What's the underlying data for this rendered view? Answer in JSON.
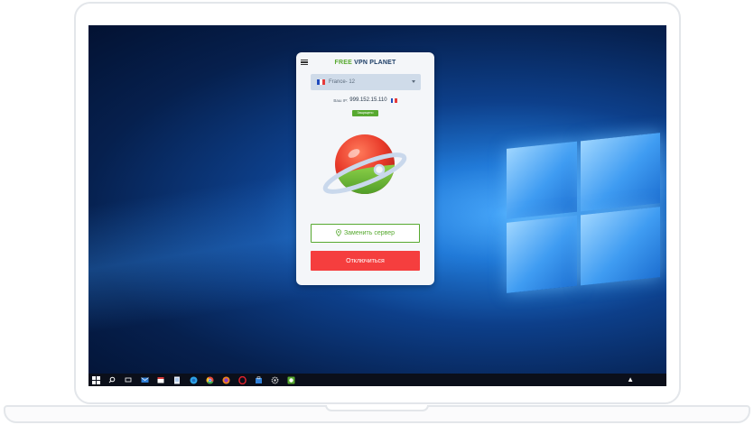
{
  "app": {
    "title_free": "FREE",
    "title_rest": " VPN PLANET",
    "server": {
      "selected": "France- 12",
      "flag_colors": [
        "#1f4bbd",
        "#ffffff",
        "#e53b3b"
      ]
    },
    "ip": {
      "label": "Ваш IP:",
      "value": "999.152.15.110"
    },
    "status_badge": "Защищено",
    "change_server_label": "Заменить сервер",
    "disconnect_label": "Отключиться",
    "colors": {
      "accent_green": "#57a930",
      "danger_red": "#f53e3e",
      "title_blue": "#1c3d66"
    }
  },
  "taskbar": {
    "icons": [
      "start-icon",
      "search-icon",
      "task-view-icon",
      "mail-icon",
      "calendar-icon",
      "document-icon",
      "edge-icon",
      "chrome-icon",
      "firefox-icon",
      "opera-icon",
      "store-icon",
      "settings-icon",
      "vpn-planet-icon"
    ],
    "tray": "▲"
  }
}
